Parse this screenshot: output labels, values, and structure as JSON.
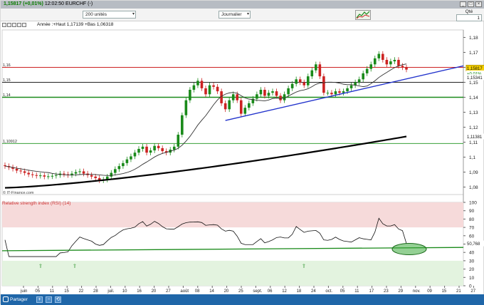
{
  "titlebar": {
    "price": "1,15817",
    "change": "(+0,01%)",
    "time": "12:02:50",
    "symbol": "EURCHF",
    "suffix": "(-)"
  },
  "window_buttons": [
    "_",
    "□",
    "×"
  ],
  "toolbar": {
    "quantity_select": "200 unités",
    "period_select": "Journalier",
    "qty_label": "Qté",
    "qty_value": "1"
  },
  "chart": {
    "info_text": "Année :+Haut 1,17139 +Bas 1,06318",
    "copyright": "© IT-Finance.com",
    "price_axis": [
      "1,18",
      "1,17",
      "1,16",
      "1,15",
      "1,14",
      "1,13",
      "1,12",
      "1,11",
      "1,1",
      "1,09",
      "1,08"
    ],
    "price_tags": {
      "current": "1,15817",
      "change": "+0,01%",
      "ma_short": "1,15341",
      "ma_long": "1,11381"
    },
    "hlines": [
      {
        "label": "1,16",
        "color": "#cc2222"
      },
      {
        "label": "1,15",
        "color": "#222222"
      },
      {
        "label": "1,14",
        "color": "#1a8a1a"
      },
      {
        "label": "1,10912",
        "color": "#3aa03a"
      }
    ],
    "x_labels": [
      "juin",
      "05",
      "11",
      "15",
      "22",
      "28",
      "juil.",
      "10",
      "16",
      "20",
      "27",
      "août",
      "08",
      "14",
      "20",
      "25",
      "sept.",
      "06",
      "12",
      "18",
      "24",
      "oct.",
      "05",
      "11",
      "17",
      "23",
      "29",
      "nov.",
      "09",
      "15",
      "21",
      "27"
    ],
    "colors": {
      "up": "#1a8a1a",
      "down": "#cc2222",
      "trend": "#2233cc",
      "ma_long": "#000000",
      "ma_short": "#333333"
    }
  },
  "indicator": {
    "title": "Relative strength index (RSI) (14)",
    "value": "50,768",
    "axis": [
      "100",
      "90",
      "80",
      "70",
      "60",
      "50",
      "40",
      "30",
      "20",
      "10",
      "0"
    ],
    "arrow_symbol": "⇧"
  },
  "statusbar": {
    "share_label": "Partager",
    "zoom_labels": [
      "+",
      "−",
      "⟲"
    ]
  },
  "chart_data": {
    "type": "candlestick",
    "symbol": "EURCHF",
    "x_labels": [
      "juin",
      "05",
      "11",
      "15",
      "22",
      "28",
      "juil.",
      "10",
      "16",
      "20",
      "27",
      "août",
      "08",
      "14",
      "20",
      "25",
      "sept.",
      "06",
      "12",
      "18",
      "24",
      "oct.",
      "05",
      "11",
      "17",
      "23",
      "29",
      "nov.",
      "09",
      "15",
      "21",
      "27"
    ],
    "close": [
      1.094,
      1.0932,
      1.0922,
      1.091,
      1.0905,
      1.0895,
      1.0885,
      1.088,
      1.0875,
      1.0878,
      1.087,
      1.0872,
      1.0875,
      1.088,
      1.089,
      1.0885,
      1.088,
      1.089,
      1.09,
      1.0905,
      1.089,
      1.088,
      1.087,
      1.086,
      1.0845,
      1.085,
      1.087,
      1.0895,
      1.092,
      1.094,
      1.096,
      1.0985,
      1.1005,
      1.103,
      1.1055,
      1.107,
      1.103,
      1.1045,
      1.1075,
      1.106,
      1.104,
      1.103,
      1.105,
      1.107,
      1.115,
      1.128,
      1.138,
      1.145,
      1.148,
      1.151,
      1.146,
      1.142,
      1.148,
      1.147,
      1.144,
      1.136,
      1.132,
      1.138,
      1.142,
      1.138,
      1.129,
      1.133,
      1.136,
      1.139,
      1.142,
      1.145,
      1.141,
      1.143,
      1.144,
      1.141,
      1.138,
      1.142,
      1.146,
      1.149,
      1.152,
      1.15,
      1.148,
      1.154,
      1.158,
      1.162,
      1.154,
      1.143,
      1.143,
      1.142,
      1.144,
      1.143,
      1.144,
      1.146,
      1.148,
      1.15,
      1.152,
      1.156,
      1.159,
      1.162,
      1.166,
      1.169,
      1.165,
      1.162,
      1.164,
      1.165,
      1.161,
      1.16,
      1.1585
    ],
    "ma_long_end": 1.11381,
    "ma_short_end": 1.15341,
    "hlines": [
      1.16,
      1.15,
      1.14,
      1.10912
    ],
    "ylim": [
      1.075,
      1.185
    ],
    "rsi": {
      "ylim": [
        0,
        100
      ],
      "last": 50.768
    }
  }
}
